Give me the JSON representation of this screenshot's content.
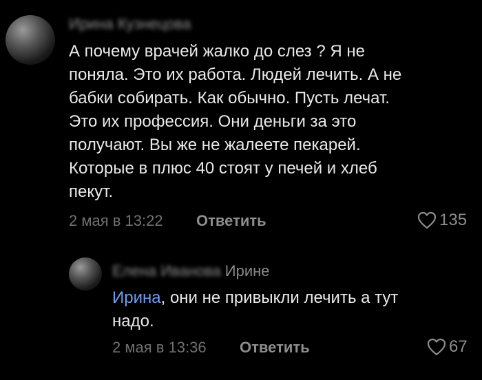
{
  "comment1": {
    "author": "Ирина Кузнецова",
    "text": "А почему врачей жалко до слез ? Я не\nпоняла. Это их работа. Людей лечить. А не\nбабки собирать. Как обычно. Пусть лечат.\nЭто их профессия. Они деньги за это\nполучают. Вы же не жалеете пекарей.\nКоторые в плюс 40 стоят у печей и хлеб\nпекут.",
    "date": "2 мая в 13:22",
    "reply_label": "Ответить",
    "likes": "135"
  },
  "comment2": {
    "author": "Елена Иванова",
    "reply_to": "Ирине",
    "mention": "Ирина",
    "text": ", они не привыкли лечить а тут\nнадо.",
    "date": "2 мая в 13:36",
    "reply_label": "Ответить",
    "likes": "67"
  },
  "colors": {
    "background": "#000000",
    "mention": "#6f9ef0",
    "muted": "#8d8d8d"
  },
  "icons": {
    "like": "heart-outline-icon"
  }
}
